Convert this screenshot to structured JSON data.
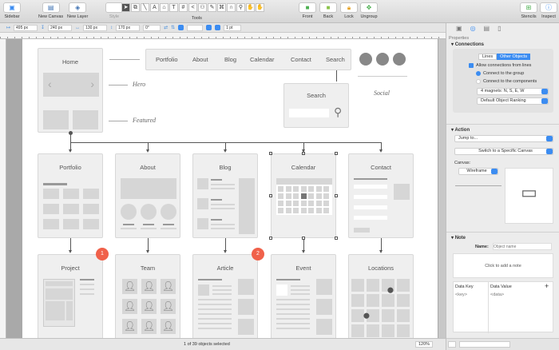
{
  "toolbar": {
    "items": [
      {
        "label": "Sidebar",
        "icon": "sidebar-icon"
      },
      {
        "label": "New Canvas",
        "icon": "new-canvas-icon"
      },
      {
        "label": "New Layer",
        "icon": "new-layer-icon"
      },
      {
        "label": "Style",
        "icon": "style-icon"
      },
      {
        "label": "Tools"
      },
      {
        "label": "Front",
        "icon": "bring-front-icon"
      },
      {
        "label": "Back",
        "icon": "send-back-icon"
      },
      {
        "label": "Lock",
        "icon": "lock-icon"
      },
      {
        "label": "Ungroup",
        "icon": "ungroup-icon"
      },
      {
        "label": "Stencils",
        "icon": "stencils-icon"
      },
      {
        "label": "Inspect",
        "icon": "inspect-icon"
      }
    ],
    "tools": [
      "➤",
      "⧉",
      "╲",
      "A",
      "⌂",
      "T",
      "#",
      "<",
      "⚇",
      "✎",
      "⌘",
      "∩",
      "⚲",
      "✋",
      "✋"
    ]
  },
  "format": {
    "x": "495 px",
    "y": "240 px",
    "width": "130 px",
    "height": "170 px",
    "rotation": "0°",
    "stroke": "1 pt"
  },
  "canvas": {
    "home": "Home",
    "nav": [
      "Portfolio",
      "About",
      "Blog",
      "Calendar",
      "Contact",
      "Search"
    ],
    "search_title": "Search",
    "annotations": {
      "hero": "Hero",
      "featured": "Featured",
      "social": "Social"
    },
    "row1": [
      "Portfolio",
      "About",
      "Blog",
      "Calendar",
      "Contact"
    ],
    "row2": [
      "Project",
      "Team",
      "Article",
      "Event",
      "Locations"
    ],
    "badges": [
      "1",
      "2"
    ],
    "badge_color": "#f0614a"
  },
  "status": {
    "selection": "1 of 39 objects selected",
    "zoom": "120%"
  },
  "inspector": {
    "tab_label": "Properties",
    "connections": {
      "title": "Connections",
      "seg": [
        "Lines",
        "Other Objects"
      ],
      "allow": "Allow connections from lines",
      "group": "Connect to the group",
      "components": "Connect to the components",
      "magnets": "4 magnets: N, S, E, W",
      "ranking": "Default Object Ranking"
    },
    "action": {
      "title": "Action",
      "jump": "Jump to...",
      "switch": "Switch to a Specific Canvas",
      "canvas_label": "Canvas:",
      "canvas_value": "Wireframe"
    },
    "note": {
      "title": "Note",
      "name_label": "Name:",
      "name_placeholder": "Object name",
      "add_note": "Click to add a note",
      "key_header": "Data Key",
      "value_header": "Data Value",
      "key": "<key>",
      "value": "<data>",
      "add": "+"
    }
  },
  "accent": "#3b8cf1"
}
